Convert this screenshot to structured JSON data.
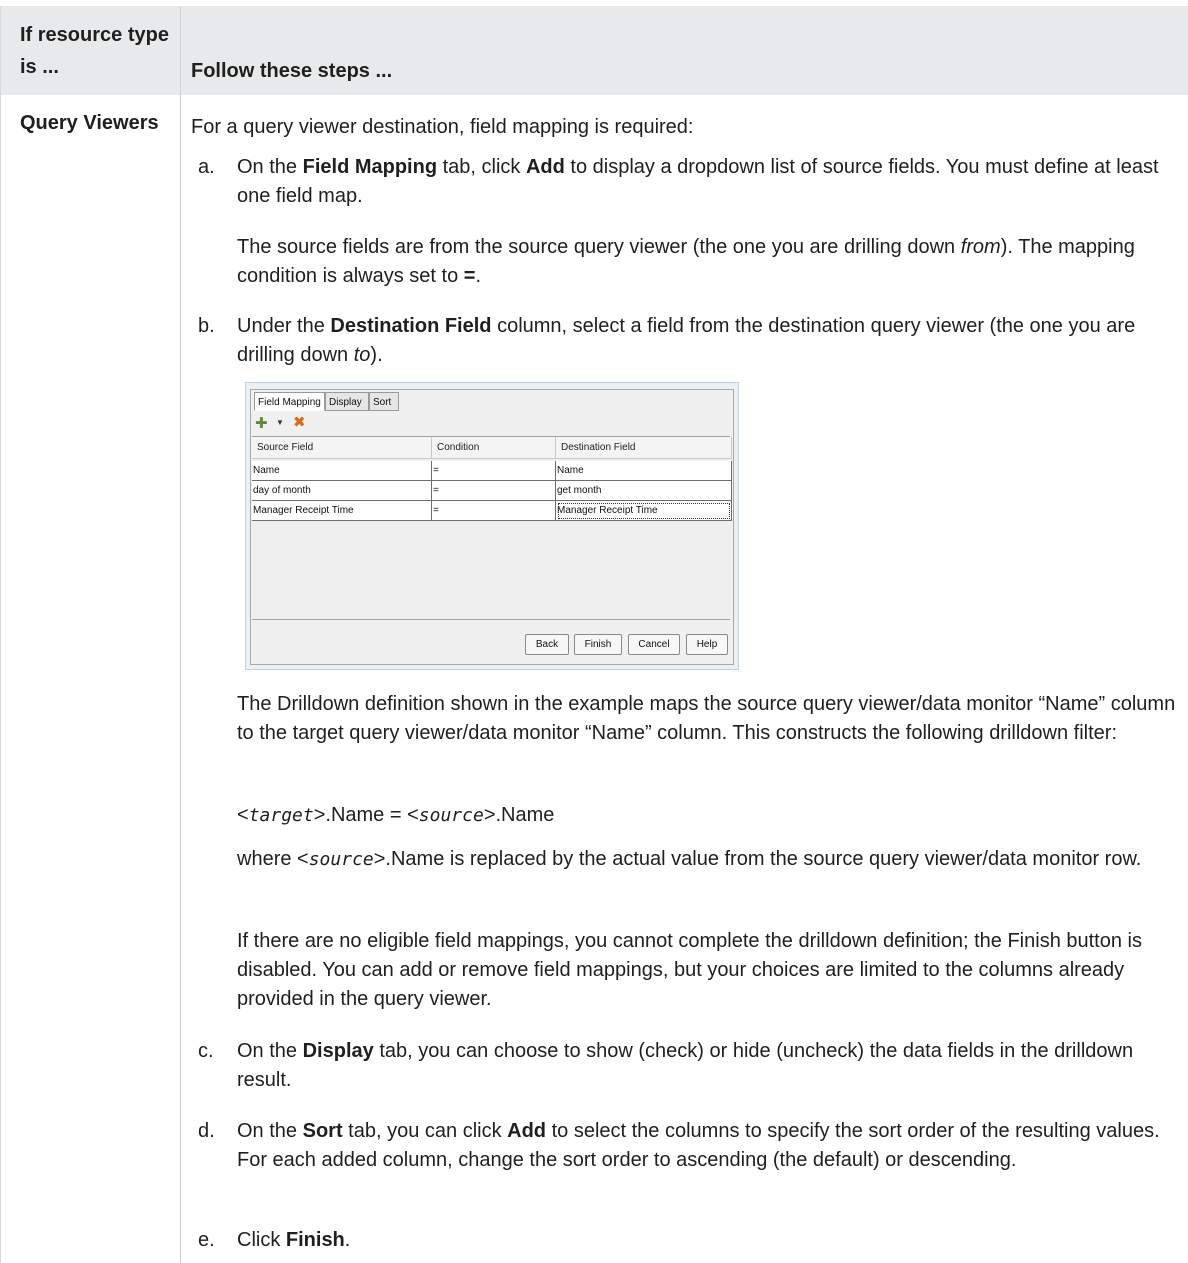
{
  "table": {
    "header": {
      "col1": "If resource type is ...",
      "col2": "Follow these steps ..."
    },
    "row": {
      "resource_type": "Query Viewers",
      "intro": "For a query viewer destination, field mapping is required:",
      "steps": {
        "a": {
          "letter": "a.",
          "t1": "On the ",
          "b1": "Field Mapping",
          "t2": " tab, click ",
          "b2": "Add",
          "t3": " to display a dropdown list of source fields. You must define at least one field map.",
          "note_t1": "The source fields are from the source query viewer (the one you are drilling down ",
          "note_i1": "from",
          "note_t2": "). The mapping condition is always set to ",
          "note_b1": "=",
          "note_t3": "."
        },
        "b": {
          "letter": "b.",
          "t1": "Under the ",
          "b1": "Destination Field",
          "t2": " column, select a field from the destination query viewer (the one you are drilling down ",
          "i1": "to",
          "t3": ").",
          "p1": "The Drilldown definition shown in the example maps the source query viewer/data monitor “Name” column to the target query viewer/data monitor “Name” column. This constructs the following drilldown filter:",
          "filter_lt1": "<",
          "filter_code1": "target",
          "filter_mid": ">.Name = <",
          "filter_code2": "source",
          "filter_end": ">.Name",
          "p3_t1": "where <",
          "p3_code": "source",
          "p3_t2": ">.Name is replaced by the actual value from the source query viewer/data monitor row.",
          "p4": "If there are no eligible field mappings, you cannot complete the drilldown definition; the Finish button is disabled. You can add or remove field mappings, but your choices are limited to the columns already provided in the query viewer."
        },
        "c": {
          "letter": "c.",
          "t1": "On the ",
          "b1": "Display",
          "t2": " tab, you can choose to show (check) or hide (uncheck) the data fields in the drilldown result."
        },
        "d": {
          "letter": "d.",
          "t1": "On the ",
          "b1": "Sort",
          "t2": " tab, you can click ",
          "b2": "Add",
          "t3": " to select the columns to specify the sort order of the resulting values. For each added column, change the sort order to ascending (the default) or descending."
        },
        "e": {
          "letter": "e.",
          "t1": "Click ",
          "b1": "Finish",
          "t2": "."
        }
      }
    }
  },
  "dialog": {
    "tabs": [
      "Field Mapping",
      "Display",
      "Sort"
    ],
    "toolbar": {
      "add_icon": "add-icon",
      "dropdown_icon": "dropdown-arrow-icon",
      "delete_icon": "delete-icon",
      "add_glyph": "✚",
      "dropdown_glyph": "▼",
      "delete_glyph": "✖"
    },
    "columns": [
      "Source Field",
      "Condition",
      "Destination Field"
    ],
    "rows": [
      [
        "Name",
        "=",
        "Name"
      ],
      [
        "day of month",
        "=",
        "get month"
      ],
      [
        "Manager Receipt Time",
        "=",
        "Manager Receipt Time"
      ]
    ],
    "buttons": {
      "back": "Back",
      "finish": "Finish",
      "cancel": "Cancel",
      "help": "Help"
    },
    "colors": {
      "add_icon": "#5a8a3a",
      "delete_icon": "#e06a10"
    }
  }
}
